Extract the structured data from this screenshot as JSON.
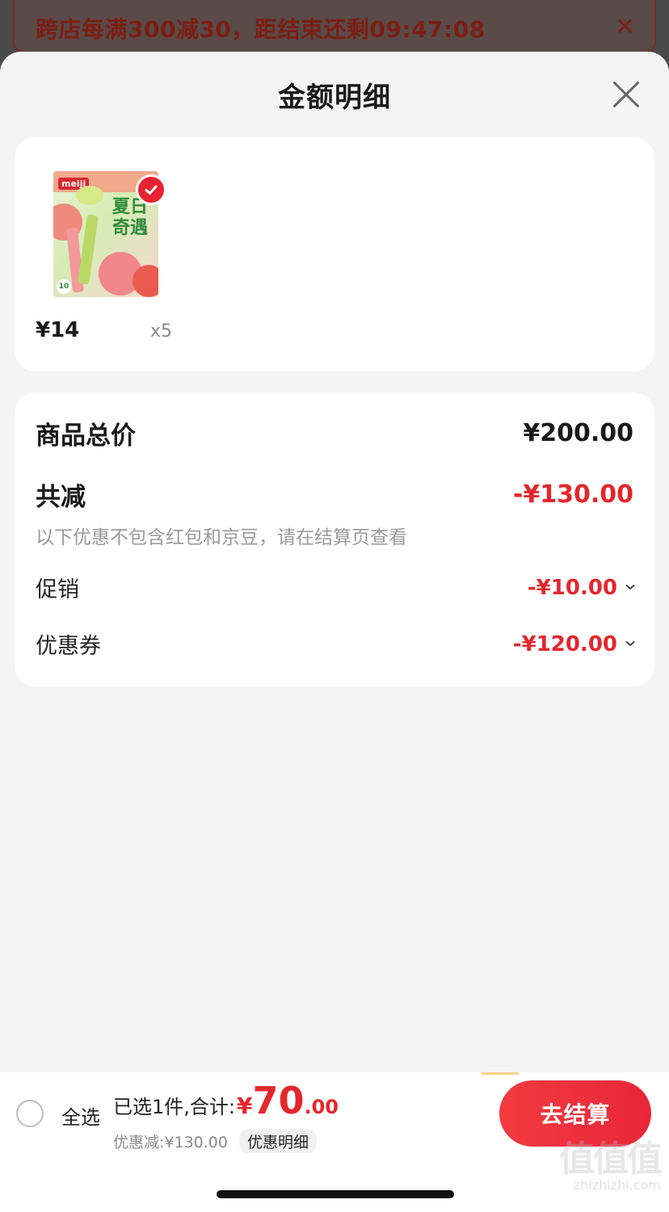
{
  "promo_banner": {
    "text": "跨店每满300减30，距结束还剩09:47:08",
    "close_icon": "close-icon"
  },
  "sheet": {
    "title": "金额明细",
    "close_icon": "close-icon"
  },
  "product": {
    "image_text": "夏日奇遇",
    "brand": "meiji",
    "image_count": "10",
    "price": "¥14",
    "quantity": "x5",
    "selected": true
  },
  "summary": {
    "total_label": "商品总价",
    "total_value": "¥200.00",
    "reduce_label": "共减",
    "reduce_value": "-¥130.00",
    "note": "以下优惠不包含红包和京豆，请在结算页查看",
    "promo_label": "促销",
    "promo_value": "-¥10.00",
    "coupon_label": "优惠券",
    "coupon_value": "-¥120.00"
  },
  "bottom_bar": {
    "select_all": "全选",
    "selected_label": "已选1件,合计:",
    "currency": "¥",
    "total_int": "70",
    "total_dec": ".00",
    "discount_text": "优惠减:¥130.00",
    "detail_tag": "优惠明细",
    "checkout_label": "去结算"
  },
  "watermark": {
    "logo": "值值值",
    "text": "zhizhizhi.com"
  },
  "colors": {
    "accent_red": "#e4262d",
    "sheet_bg": "#f4f4f4",
    "card_bg": "#ffffff"
  }
}
